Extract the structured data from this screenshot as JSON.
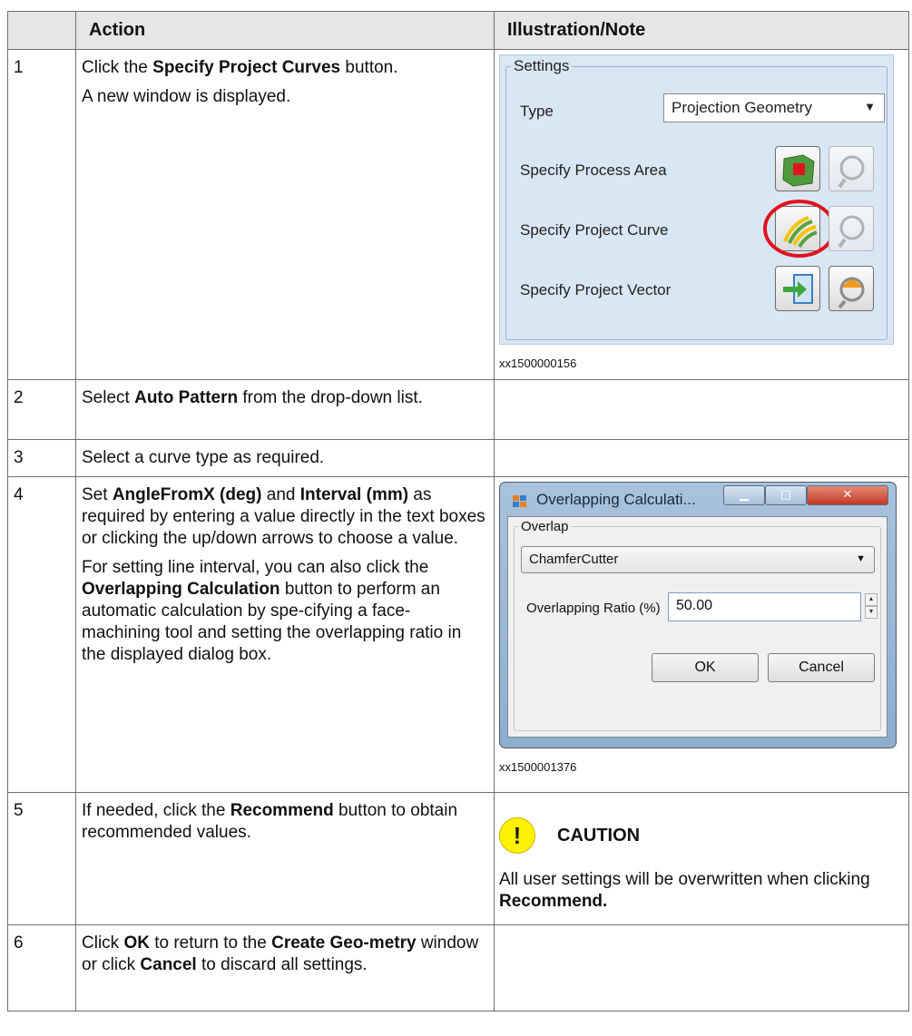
{
  "table": {
    "header": {
      "number": "",
      "action": "Action",
      "note": "Illustration/Note"
    },
    "rows": [
      {
        "number": "1"
      },
      {
        "number": "2"
      },
      {
        "number": "3"
      },
      {
        "number": "4"
      },
      {
        "number": "5"
      },
      {
        "number": "6"
      }
    ]
  },
  "step1": {
    "t1": "Click the ",
    "b1": "Specify Project Curves",
    "t2": " button.",
    "line2": "A new window is displayed.",
    "caption": "xx1500000156",
    "settings": {
      "group_title": "Settings",
      "type_label": "Type",
      "type_value": "Projection Geometry",
      "process_area_label": "Specify Process Area",
      "project_curve_label": "Specify Project Curve",
      "project_vector_label": "Specify Project Vector"
    }
  },
  "step2": {
    "t1": "Select ",
    "b1": "Auto Pattern",
    "t2": " from the drop-down list."
  },
  "step3": {
    "t1": "Select a curve type as required."
  },
  "step4": {
    "t1": "Set ",
    "b1": "AngleFromX (deg)",
    "t2": " and ",
    "b2": "Interval (mm)",
    "t3": " as required by entering a value directly in the text boxes or clicking the up/down arrows to choose a value.",
    "p2_t1": "For setting line interval, you can also click the ",
    "p2_b1": "Overlapping Calculation",
    "p2_t2": " button to perform an automatic calculation by spe-cifying a face-machining tool and setting the overlapping ratio in the displayed dialog box.",
    "caption": "xx1500001376",
    "dialog": {
      "title": "Overlapping Calculati...",
      "group_title": "Overlap",
      "tool_value": "ChamferCutter",
      "ratio_label": "Overlapping Ratio (%)",
      "ratio_value": "50.00",
      "ok_label": "OK",
      "cancel_label": "Cancel"
    }
  },
  "step5": {
    "t1": "If needed, click the ",
    "b1": "Recommend",
    "t2": " button to obtain recommended values.",
    "caution_title": "CAUTION",
    "caution_t1": "All user settings will be overwritten when clicking ",
    "caution_b1": "Recommend."
  },
  "step6": {
    "t1": "Click ",
    "b1": "OK",
    "t2": " to return to the ",
    "b2": "Create Geo-metry",
    "t3": " window or click ",
    "b3": "Cancel",
    "t4": " to discard all settings."
  },
  "colors": {
    "header_bg": "#e6e6e6",
    "panel_bg": "#d9e6f3",
    "caution_yellow": "#fff200",
    "highlight_red": "#e0141e"
  }
}
